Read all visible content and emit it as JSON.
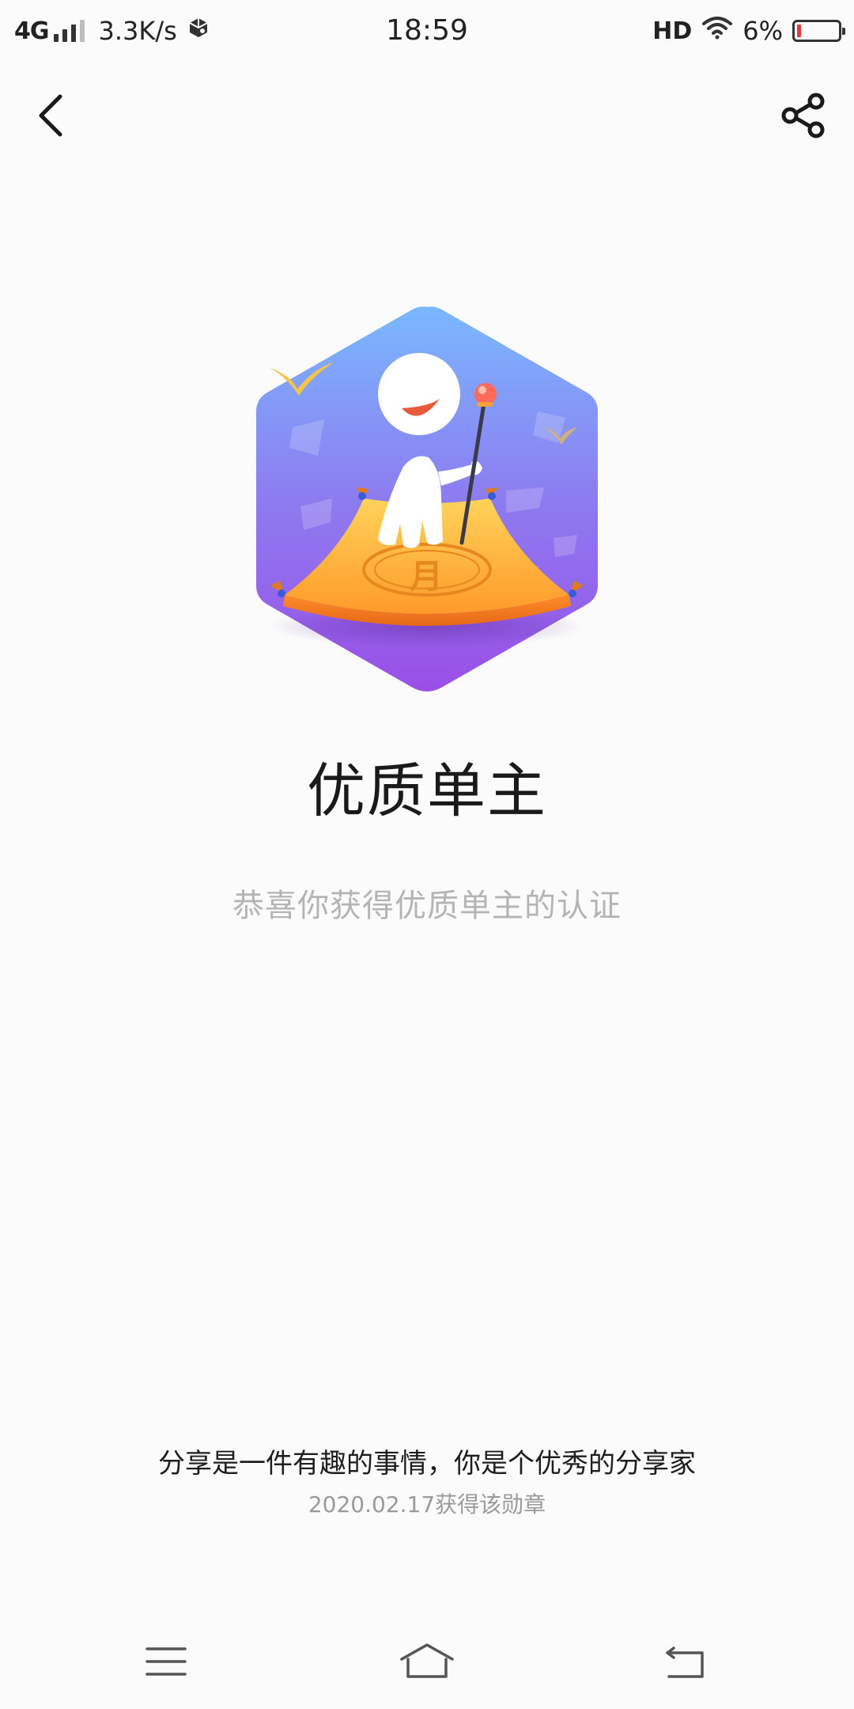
{
  "status_bar": {
    "network": "4G",
    "speed": "3.3K/s",
    "time": "18:59",
    "hd": "HD",
    "battery": "6%"
  },
  "app_bar": {
    "back_icon": "chevron-left-icon",
    "share_icon": "share-icon"
  },
  "badge": {
    "emblem_char": "月",
    "title": "优质单主",
    "subtitle": "恭喜你获得优质单主的认证"
  },
  "footer": {
    "motto": "分享是一件有趣的事情，你是个优秀的分享家",
    "date": "2020.02.17获得该勋章"
  },
  "nav_bar": {
    "menu_icon": "menu-icon",
    "home_icon": "home-icon",
    "back_icon": "back-arrow-icon"
  },
  "colors": {
    "badge_top": "#7ab8ff",
    "badge_mid": "#8d7cf0",
    "badge_bottom": "#9a4fe6",
    "cloth": "#ffb43a",
    "cloth_edge": "#f08a1e",
    "battery_low": "#e53935"
  }
}
